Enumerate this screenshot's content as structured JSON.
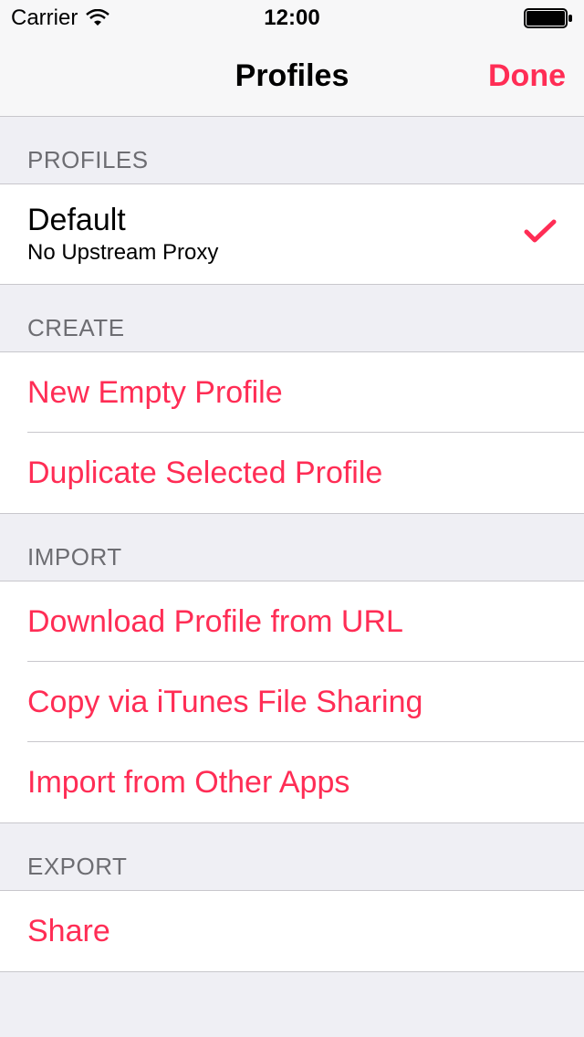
{
  "status_bar": {
    "carrier": "Carrier",
    "time": "12:00"
  },
  "nav": {
    "title": "Profiles",
    "done": "Done"
  },
  "sections": {
    "profiles": {
      "header": "PROFILES",
      "items": [
        {
          "title": "Default",
          "subtitle": "No Upstream Proxy",
          "selected": true
        }
      ]
    },
    "create": {
      "header": "CREATE",
      "items": [
        {
          "label": "New Empty Profile"
        },
        {
          "label": "Duplicate Selected Profile"
        }
      ]
    },
    "import": {
      "header": "IMPORT",
      "items": [
        {
          "label": "Download Profile from URL"
        },
        {
          "label": "Copy via iTunes File Sharing"
        },
        {
          "label": "Import from Other Apps"
        }
      ]
    },
    "export": {
      "header": "EXPORT",
      "items": [
        {
          "label": "Share"
        }
      ]
    }
  }
}
